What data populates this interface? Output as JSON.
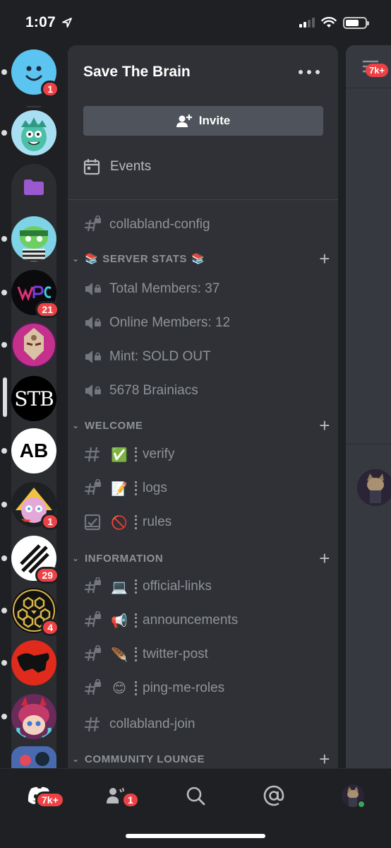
{
  "status_bar": {
    "time": "1:07"
  },
  "rail": {
    "servers": [
      {
        "name": "smiley",
        "badge": "1"
      },
      {
        "name": "sea-monster",
        "badge": ""
      },
      {
        "name": "folder",
        "badge": ""
      },
      {
        "name": "frog-bandana",
        "badge": ""
      },
      {
        "name": "neon-logo",
        "badge": "21"
      },
      {
        "name": "masked-robot",
        "badge": ""
      },
      {
        "name": "stb",
        "badge": "",
        "label": "STB"
      },
      {
        "name": "ab",
        "badge": "",
        "label": "AB"
      },
      {
        "name": "cheese-monster",
        "badge": "1"
      },
      {
        "name": "stripes",
        "badge": "29"
      },
      {
        "name": "honeycomb",
        "badge": "4"
      },
      {
        "name": "red-bull",
        "badge": ""
      },
      {
        "name": "devil-girl",
        "badge": ""
      }
    ]
  },
  "server": {
    "title": "Save The Brain",
    "invite_label": "Invite",
    "events_label": "Events"
  },
  "channels": {
    "top": [
      {
        "name": "collabland-config",
        "icon": "locked-hash"
      }
    ],
    "categories": [
      {
        "name": "SERVER STATS",
        "emoji": "📚",
        "items": [
          {
            "name": "Total Members: 37",
            "icon": "voice-locked"
          },
          {
            "name": "Online Members: 12",
            "icon": "voice-locked"
          },
          {
            "name": "Mint: SOLD OUT",
            "icon": "voice-locked"
          },
          {
            "name": "5678 Brainiacs",
            "icon": "voice-locked"
          }
        ]
      },
      {
        "name": "WELCOME",
        "items": [
          {
            "name": "verify",
            "emoji": "✅",
            "icon": "hash"
          },
          {
            "name": "logs",
            "emoji": "📝",
            "icon": "locked-hash"
          },
          {
            "name": "rules",
            "emoji": "🚫",
            "icon": "rules"
          }
        ]
      },
      {
        "name": "INFORMATION",
        "items": [
          {
            "name": "official-links",
            "emoji": "💻",
            "icon": "locked-hash"
          },
          {
            "name": "announcements",
            "emoji": "📢",
            "icon": "locked-hash"
          },
          {
            "name": "twitter-post",
            "emoji": "🪶",
            "icon": "locked-hash"
          },
          {
            "name": "ping-me-roles",
            "emoji": "😊",
            "icon": "locked-hash"
          },
          {
            "name": "collabland-join",
            "icon": "hash"
          }
        ]
      },
      {
        "name": "COMMUNITY LOUNGE",
        "items": []
      }
    ]
  },
  "peek": {
    "badge": "7k+"
  },
  "bottom_nav": {
    "home_badge": "7k+",
    "friends_badge": "1"
  },
  "colors": {
    "accent_red": "#ed4245",
    "panel": "#2f3136",
    "folder_purple": "#9b59d0"
  }
}
